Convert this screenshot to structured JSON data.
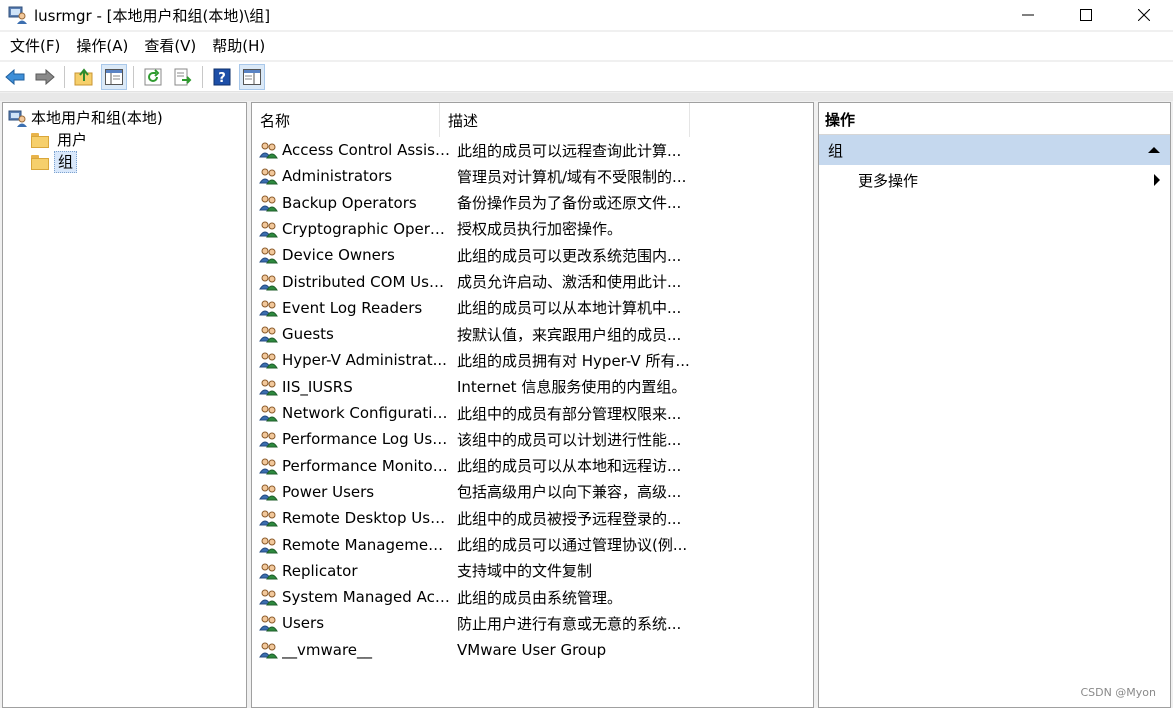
{
  "window": {
    "title": "lusrmgr - [本地用户和组(本地)\\组]",
    "minimize_glyph": "—",
    "maximize_glyph": "☐",
    "close_glyph": "✕"
  },
  "menu": [
    {
      "label": "文件(F)"
    },
    {
      "label": "操作(A)"
    },
    {
      "label": "查看(V)"
    },
    {
      "label": "帮助(H)"
    }
  ],
  "toolbar": {
    "icons": [
      "back-arrow-icon",
      "forward-arrow-icon",
      "up-folder-icon",
      "show-hide-tree-icon",
      "refresh-icon",
      "export-list-icon",
      "help-icon",
      "show-hide-action-pane-icon"
    ]
  },
  "tree": {
    "root": "本地用户和组(本地)",
    "items": [
      {
        "label": "用户"
      },
      {
        "label": "组"
      }
    ]
  },
  "list": {
    "columns": [
      "名称",
      "描述"
    ],
    "rows": [
      {
        "name": "Access Control Assist...",
        "desc": "此组的成员可以远程查询此计算..."
      },
      {
        "name": "Administrators",
        "desc": "管理员对计算机/域有不受限制的..."
      },
      {
        "name": "Backup Operators",
        "desc": "备份操作员为了备份或还原文件..."
      },
      {
        "name": "Cryptographic Operat...",
        "desc": "授权成员执行加密操作。"
      },
      {
        "name": "Device Owners",
        "desc": "此组的成员可以更改系统范围内..."
      },
      {
        "name": "Distributed COM Users",
        "desc": "成员允许启动、激活和使用此计..."
      },
      {
        "name": "Event Log Readers",
        "desc": "此组的成员可以从本地计算机中..."
      },
      {
        "name": "Guests",
        "desc": "按默认值，来宾跟用户组的成员..."
      },
      {
        "name": "Hyper-V Administrat...",
        "desc": "此组的成员拥有对 Hyper-V 所有..."
      },
      {
        "name": "IIS_IUSRS",
        "desc": "Internet 信息服务使用的内置组。"
      },
      {
        "name": "Network Configuratio...",
        "desc": "此组中的成员有部分管理权限来..."
      },
      {
        "name": "Performance Log Users",
        "desc": "该组中的成员可以计划进行性能..."
      },
      {
        "name": "Performance Monitor...",
        "desc": "此组的成员可以从本地和远程访..."
      },
      {
        "name": "Power Users",
        "desc": "包括高级用户以向下兼容，高级..."
      },
      {
        "name": "Remote Desktop Users",
        "desc": "此组中的成员被授予远程登录的..."
      },
      {
        "name": "Remote Managemen...",
        "desc": "此组的成员可以通过管理协议(例..."
      },
      {
        "name": "Replicator",
        "desc": "支持域中的文件复制"
      },
      {
        "name": "System Managed Acc...",
        "desc": "此组的成员由系统管理。"
      },
      {
        "name": "Users",
        "desc": "防止用户进行有意或无意的系统..."
      },
      {
        "name": "__vmware__",
        "desc": "VMware User Group"
      }
    ]
  },
  "actions": {
    "header": "操作",
    "group": "组",
    "more": "更多操作"
  },
  "watermark": "CSDN @Myon⁣",
  "colors": {
    "selection": "#d9e8fb",
    "action_group": "#c5d8ee",
    "toolbar_active": "#dbe9f7"
  }
}
